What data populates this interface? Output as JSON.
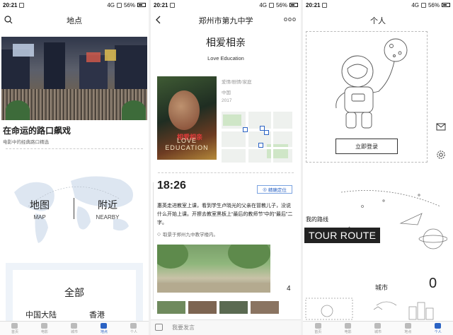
{
  "statusbar": {
    "time": "20:21",
    "network": "4G",
    "battery": "56%"
  },
  "screen1": {
    "nav_title": "地点",
    "feature_title": "在命运的路口飙戏",
    "feature_subtitle": "电影中的经典路口精选",
    "map_zh": "地图",
    "map_en": "MAP",
    "nearby_zh": "附近",
    "nearby_en": "NEARBY",
    "all_title": "全部",
    "region_a": "中国大陆",
    "region_b": "香港",
    "tabs": [
      "首页",
      "电影",
      "城市",
      "地点",
      "个人"
    ],
    "active_tab": 3
  },
  "screen2": {
    "nav_title": "郑州市第九中学",
    "nav_more": "ooo",
    "movie_title": "相爱相亲",
    "movie_en": "Love Education",
    "genre": "爱情/剧情/家庭",
    "country": "中国",
    "year": "2017",
    "poster_en": "LOVE EDUCATION",
    "poster_zh": "相爱相亲",
    "scene_time": "18:26",
    "locate_label": "精确定位",
    "story": "惠英走进教室上课，看到学生卢晓光的父亲在冒教儿子，没说什么开始上课。开擦去教室黑板上“最后的教师节”中的“最后”二字。",
    "source": "取景于郑州九中教学楼内。",
    "photo_count": "4",
    "comment_placeholder": "我要发言"
  },
  "screen3": {
    "nav_title": "个人",
    "login_label": "立即登录",
    "my_route": "我的路线",
    "tour_route": "TOUR ROUTE",
    "city_label": "城市",
    "city_count": "0",
    "tabs": [
      "首页",
      "电影",
      "城市",
      "地点",
      "个人"
    ],
    "active_tab": 4
  },
  "colors": {
    "accent": "#2b63c4",
    "dark": "#222222"
  }
}
